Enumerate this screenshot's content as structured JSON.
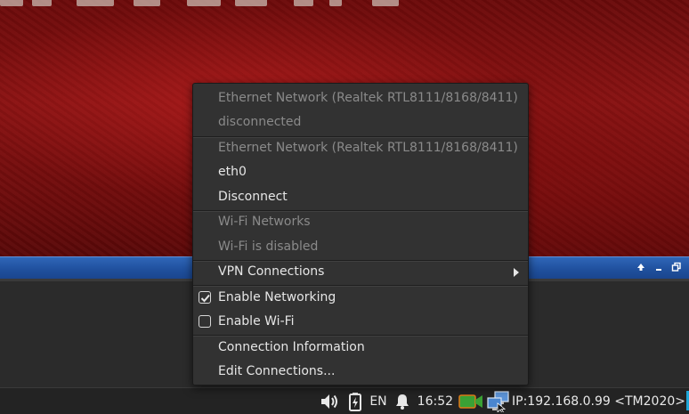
{
  "menu": {
    "items": [
      {
        "label": "Ethernet Network (Realtek RTL8111/8168/8411)",
        "state": "disabled"
      },
      {
        "label": "disconnected",
        "state": "disabled"
      },
      {
        "label": "Ethernet Network (Realtek RTL8111/8168/8411)",
        "state": "disabled"
      },
      {
        "label": "eth0",
        "state": "enabled"
      },
      {
        "label": "Disconnect",
        "state": "enabled"
      },
      {
        "label": "Wi-Fi Networks",
        "state": "disabled"
      },
      {
        "label": "Wi-Fi is disabled",
        "state": "disabled"
      },
      {
        "label": "VPN Connections",
        "state": "enabled",
        "submenu": true
      },
      {
        "label": "Enable Networking",
        "state": "enabled",
        "checked": true
      },
      {
        "label": "Enable Wi-Fi",
        "state": "enabled",
        "checked": false
      },
      {
        "label": "Connection Information",
        "state": "enabled"
      },
      {
        "label": "Edit Connections...",
        "state": "enabled"
      }
    ]
  },
  "window": {
    "controls": [
      "up-arrow-icon",
      "minimize-icon",
      "restore-icon"
    ],
    "titlebar_color": "#2f66b8"
  },
  "tray": {
    "volume_icon": "speaker-icon",
    "battery_icon": "battery-charging-icon",
    "language": "EN",
    "notification_icon": "bell-icon",
    "time": "16:52",
    "camera_icon": "video-camera-icon",
    "network_icon": "network-computers-icon",
    "ip_label": "IP:192.168.0.99 <TM2020>"
  },
  "colors": {
    "menu_bg": "#323232",
    "text_normal": "#e6e6e6",
    "text_disabled": "#8a8a8a",
    "taskbar_bg": "#232323"
  }
}
